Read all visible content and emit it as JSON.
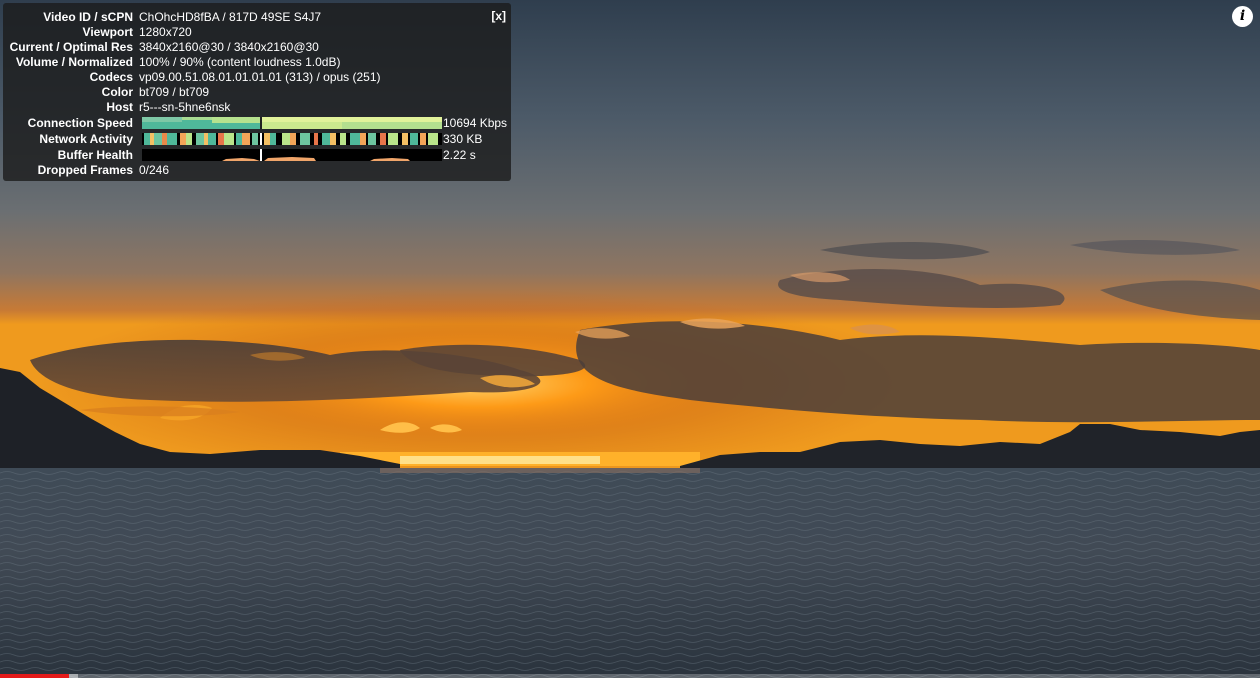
{
  "stats": {
    "close_label": "[x]",
    "rows": [
      {
        "label": "Video ID / sCPN",
        "value": "ChOhcHD8fBA / 817D 49SE S4J7"
      },
      {
        "label": "Viewport",
        "value": "1280x720"
      },
      {
        "label": "Current / Optimal Res",
        "value": "3840x2160@30 / 3840x2160@30"
      },
      {
        "label": "Volume / Normalized",
        "value": "100% / 90% (content loudness 1.0dB)"
      },
      {
        "label": "Codecs",
        "value": "vp09.00.51.08.01.01.01.01 (313) / opus (251)"
      },
      {
        "label": "Color",
        "value": "bt709 / bt709"
      },
      {
        "label": "Host",
        "value": "r5---sn-5hne6nsk"
      }
    ],
    "graphs": [
      {
        "label": "Connection Speed",
        "value": "10694 Kbps"
      },
      {
        "label": "Network Activity",
        "value": "330 KB"
      },
      {
        "label": "Buffer Health",
        "value": "2.22 s"
      }
    ],
    "dropped_frames": {
      "label": "Dropped Frames",
      "value": "0/246"
    }
  },
  "info_button": {
    "icon": "info-icon",
    "glyph": "i"
  },
  "progress": {
    "played_fraction": 0.055,
    "buffered_fraction": 0.062,
    "played_color": "#e41a1a"
  }
}
